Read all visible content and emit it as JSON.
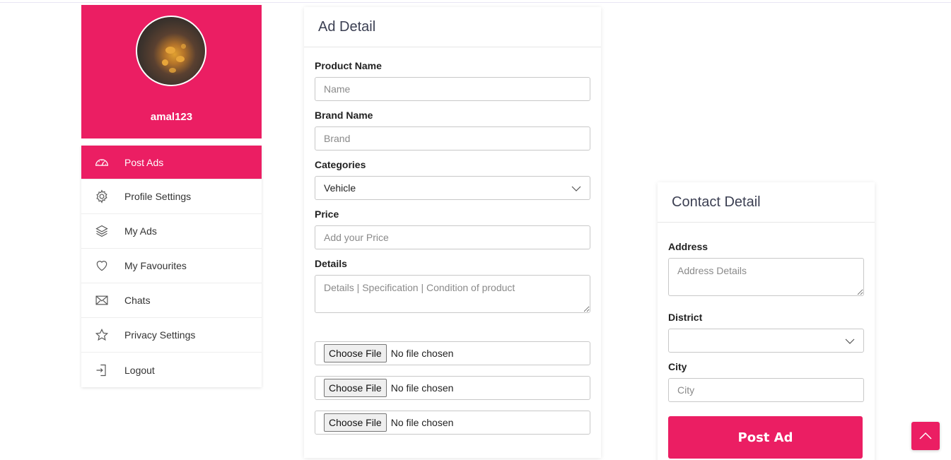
{
  "colors": {
    "accent": "#eb1e63",
    "text": "#333333",
    "border": "#c8c8c8"
  },
  "profile": {
    "username": "amal123",
    "avatar_icon": "avatar-photo"
  },
  "menu": {
    "items": [
      {
        "label": "Post Ads",
        "icon": "dashboard-icon",
        "active": true
      },
      {
        "label": "Profile Settings",
        "icon": "gear-icon"
      },
      {
        "label": "My Ads",
        "icon": "layers-icon"
      },
      {
        "label": "My Favourites",
        "icon": "heart-icon"
      },
      {
        "label": "Chats",
        "icon": "envelope-icon"
      },
      {
        "label": "Privacy Settings",
        "icon": "star-icon"
      },
      {
        "label": "Logout",
        "icon": "logout-icon"
      }
    ]
  },
  "ad_detail": {
    "title": "Ad Detail",
    "product_name": {
      "label": "Product Name",
      "placeholder": "Name"
    },
    "brand_name": {
      "label": "Brand Name",
      "placeholder": "Brand"
    },
    "categories": {
      "label": "Categories",
      "value": "Vehicle"
    },
    "price": {
      "label": "Price",
      "placeholder": "Add your Price"
    },
    "details": {
      "label": "Details",
      "placeholder": "Details | Specification | Condition of product"
    },
    "files": [
      {
        "button": "Choose File",
        "status": "No file chosen"
      },
      {
        "button": "Choose File",
        "status": "No file chosen"
      },
      {
        "button": "Choose File",
        "status": "No file chosen"
      }
    ]
  },
  "contact_detail": {
    "title": "Contact Detail",
    "address": {
      "label": "Address",
      "placeholder": "Address Details"
    },
    "district": {
      "label": "District",
      "value": ""
    },
    "city": {
      "label": "City",
      "placeholder": "City"
    },
    "submit_label": "Post Ad"
  },
  "scroll_top_icon": "chevron-up-icon"
}
